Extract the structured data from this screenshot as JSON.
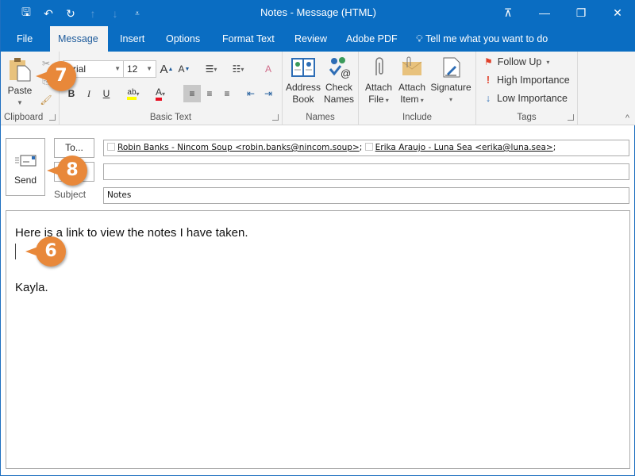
{
  "window": {
    "title": "Notes - Message (HTML)",
    "quick_access": [
      {
        "icon": "save-icon",
        "glyph": "🖫"
      },
      {
        "icon": "undo-icon",
        "glyph": "↶"
      },
      {
        "icon": "redo-icon",
        "glyph": "↻"
      },
      {
        "icon": "up-arrow-icon",
        "glyph": "↑"
      },
      {
        "icon": "down-arrow-icon",
        "glyph": "↓"
      },
      {
        "icon": "customize-qat-icon",
        "glyph": "⩡"
      }
    ],
    "controls": {
      "ribbon_display": "⊼",
      "minimize": "—",
      "restore": "❐",
      "close": "✕"
    }
  },
  "tabs": {
    "file": "File",
    "message": "Message",
    "insert": "Insert",
    "options": "Options",
    "format_text": "Format Text",
    "review": "Review",
    "adobe_pdf": "Adobe PDF",
    "tell_me": "Tell me what you want to do"
  },
  "ribbon": {
    "clipboard": {
      "label": "Clipboard",
      "paste": "Paste"
    },
    "basic_text": {
      "label": "Basic Text",
      "font": "Arial",
      "size": "12",
      "bold": "B",
      "italic": "I",
      "underline": "U",
      "highlight_color": "#ffff00",
      "font_color": "#e81123"
    },
    "names": {
      "label": "Names",
      "address_book": [
        "Address",
        "Book"
      ],
      "check_names": [
        "Check",
        "Names"
      ]
    },
    "include": {
      "label": "Include",
      "attach_file": [
        "Attach",
        "File"
      ],
      "attach_item": [
        "Attach",
        "Item"
      ],
      "signature": "Signature"
    },
    "tags": {
      "label": "Tags",
      "follow_up": "Follow Up",
      "high_importance": "High Importance",
      "low_importance": "Low Importance"
    }
  },
  "compose": {
    "send": "Send",
    "to_button": "To...",
    "subject_label": "Subject",
    "recipients": [
      "Robin Banks - Nincom Soup <robin.banks@nincom.soup>",
      "Erika Araujo - Luna Sea <erika@luna.sea>"
    ],
    "cc_value": "",
    "subject_value": "Notes"
  },
  "body": {
    "lines": [
      "Here is a link to view the notes I have taken.",
      "",
      "",
      "Kayla."
    ]
  },
  "callouts": {
    "paste": "7",
    "send": "8",
    "cursor": "6"
  },
  "colors": {
    "accent": "#0a6dc2",
    "callout": "#e8883a"
  }
}
